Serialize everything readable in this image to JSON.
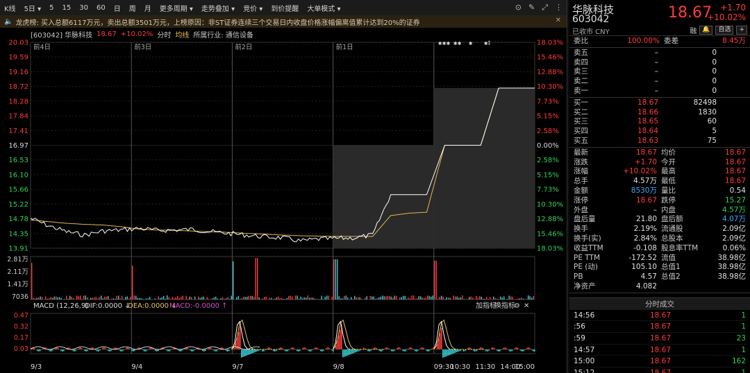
{
  "toolbar": {
    "items": [
      "K线",
      "5日 ▾",
      "5",
      "15",
      "30",
      "60",
      "日",
      "周",
      "月",
      "更多周期 ▾",
      "走势叠加 ▾",
      "竞价 ▾",
      "到价提醒",
      "大单模式 ▾"
    ]
  },
  "notice": {
    "label": "龙虎榜:",
    "text": "买入总额6117万元，卖出总额3501万元，上榜原因：非ST证券连续三个交易日内收盘价格涨幅偏离值累计达到20%的证券"
  },
  "chart_header": {
    "code": "[603042] 华脉科技",
    "price": "18.67",
    "change": "+10.02%",
    "mode": "分时",
    "avg": "均线",
    "industry": "所属行业: 通信设备"
  },
  "chart_data": [
    {
      "type": "line",
      "title": "",
      "days": [
        "前4日",
        "前3日",
        "前2日",
        "前1日",
        "今日"
      ],
      "y_ticks_left": [
        "20.03",
        "19.59",
        "19.16",
        "18.72",
        "18.28",
        "17.84",
        "17.41",
        "16.97",
        "16.53",
        "16.10",
        "15.66",
        "15.22",
        "14.78",
        "14.35",
        "13.91"
      ],
      "y_ticks_right": [
        "18.03%",
        "15.46%",
        "12.88%",
        "10.30%",
        "7.73%",
        "5.15%",
        "2.58%",
        "0.00%",
        "2.58%",
        "5.15%",
        "7.73%",
        "10.30%",
        "12.88%",
        "15.46%",
        "18.03%"
      ],
      "ylim": [
        13.91,
        20.03
      ],
      "prev_close": 16.97,
      "series": [
        {
          "values": [
            14.8,
            14.58,
            14.4,
            14.3,
            14.42,
            14.45,
            14.5,
            14.44,
            14.45,
            14.47,
            14.4,
            14.35,
            14.3,
            14.25,
            14.22,
            14.12,
            14.18,
            14.2,
            14.22,
            14.3,
            15.5,
            15.5,
            15.5,
            16.97,
            16.97,
            16.97,
            18.67,
            18.67,
            18.67
          ]
        },
        {
          "values": [
            14.75,
            14.7,
            14.65,
            14.62,
            14.6,
            14.55,
            14.48,
            14.45,
            14.44,
            14.42,
            14.4,
            14.38,
            14.35,
            14.33,
            14.3,
            14.28,
            14.27,
            14.26,
            14.26,
            14.26,
            14.88,
            14.95,
            14.98,
            16.97,
            16.97,
            16.97,
            18.67,
            18.67,
            18.67
          ]
        }
      ]
    },
    {
      "type": "bar",
      "title": "",
      "y_ticks": [
        "2.81万",
        "2.11万",
        "1.41万",
        "7036"
      ]
    },
    {
      "type": "line",
      "title": "MACD (12,26,9)",
      "y_ticks": [
        "0.47",
        "0.32",
        "0.17",
        "0.03"
      ],
      "x_ticks": [
        "9/3",
        "9/4",
        "9/7",
        "9/8",
        "09:30",
        "10:30",
        "11:30",
        "14:00",
        "15:00"
      ]
    }
  ],
  "macd": {
    "name": "MACD (12,26,9)",
    "dif": "DIF:0.0000",
    "dea": "DEA:0.0000",
    "macd": "MACD:-0.0000",
    "add": "加指标",
    "swap": "换指标"
  },
  "quote": {
    "name": "华脉科技",
    "code": "603042",
    "status": "已收市 CNY",
    "price": "18.67",
    "change": "+1.70",
    "change_pct": "+10.02%",
    "tools": [
      "融",
      "自选",
      "+"
    ],
    "weibi": {
      "label": "委比",
      "value": "100.00%",
      "label2": "委差",
      "value2": "8.45万"
    },
    "asks": [
      {
        "label": "卖五",
        "price": "–",
        "vol": "0"
      },
      {
        "label": "卖四",
        "price": "–",
        "vol": "0"
      },
      {
        "label": "卖三",
        "price": "–",
        "vol": "0"
      },
      {
        "label": "卖二",
        "price": "–",
        "vol": "0"
      },
      {
        "label": "卖一",
        "price": "–",
        "vol": "0"
      }
    ],
    "bids": [
      {
        "label": "买一",
        "price": "18.67",
        "vol": "82498"
      },
      {
        "label": "买二",
        "price": "18.66",
        "vol": "1830"
      },
      {
        "label": "买三",
        "price": "18.65",
        "vol": "60"
      },
      {
        "label": "买四",
        "price": "18.64",
        "vol": "5"
      },
      {
        "label": "买五",
        "price": "18.63",
        "vol": "75"
      }
    ],
    "stats": [
      {
        "l1": "最新",
        "v1": "18.67",
        "c1": "red",
        "l2": "均价",
        "v2": "18.67",
        "c2": "red"
      },
      {
        "l1": "涨跌",
        "v1": "+1.70",
        "c1": "red",
        "l2": "今开",
        "v2": "18.67",
        "c2": "red"
      },
      {
        "l1": "涨幅",
        "v1": "+10.02%",
        "c1": "red",
        "l2": "最高",
        "v2": "18.67",
        "c2": "red"
      },
      {
        "l1": "总手",
        "v1": "4.57万",
        "c1": "white",
        "l2": "最低",
        "v2": "18.67",
        "c2": "red"
      },
      {
        "l1": "金额",
        "v1": "8530万",
        "c1": "blue",
        "l2": "量比",
        "v2": "0.54",
        "c2": "white"
      },
      {
        "l1": "涨停",
        "v1": "18.67",
        "c1": "red",
        "l2": "跌停",
        "v2": "15.27",
        "c2": "green"
      },
      {
        "l1": "外盘",
        "v1": "–",
        "c1": "white",
        "l2": "内盘",
        "v2": "4.57万",
        "c2": "green"
      },
      {
        "l1": "盘后量",
        "v1": "21.80",
        "c1": "white",
        "l2": "盘后额",
        "v2": "4.07万",
        "c2": "blue"
      },
      {
        "l1": "换手",
        "v1": "2.19%",
        "c1": "white",
        "l2": "流通股",
        "v2": "2.09亿",
        "c2": "white"
      },
      {
        "l1": "换手(实)",
        "v1": "2.84%",
        "c1": "white",
        "l2": "总股本",
        "v2": "2.09亿",
        "c2": "white"
      },
      {
        "l1": "收益TTM",
        "v1": "-0.108",
        "c1": "white",
        "l2": "股息率TTM",
        "v2": "0.06%",
        "c2": "white"
      },
      {
        "l1": "PE TTM",
        "v1": "-172.52",
        "c1": "white",
        "l2": "流值",
        "v2": "38.98亿",
        "c2": "white"
      },
      {
        "l1": "PE (动)",
        "v1": "105.10",
        "c1": "white",
        "l2": "总值1",
        "v2": "38.98亿",
        "c2": "white"
      },
      {
        "l1": "PB",
        "v1": "4.57",
        "c1": "white",
        "l2": "总值2",
        "v2": "38.98亿",
        "c2": "white"
      },
      {
        "l1": "净资产",
        "v1": "4.082",
        "c1": "white",
        "l2": "",
        "v2": "",
        "c2": "white"
      }
    ],
    "ticks_title": "分时成交",
    "ticks": [
      {
        "time": "14:56",
        "price": "18.67",
        "vol": "1"
      },
      {
        "time": ":56",
        "price": "18.67",
        "vol": "1"
      },
      {
        "time": ":59",
        "price": "18.67",
        "vol": "23"
      },
      {
        "time": "14:57",
        "price": "18.67",
        "vol": "1"
      },
      {
        "time": "15:00",
        "price": "18.67",
        "vol": "162"
      },
      {
        "time": "15:12",
        "price": "18.67",
        "vol": "1"
      }
    ]
  },
  "colors": {
    "up": "#ff3b3b",
    "down": "#2fd35d",
    "price_line": "#ffffff",
    "avg_line": "#e8b84a",
    "amount": "#3fa9ff"
  }
}
